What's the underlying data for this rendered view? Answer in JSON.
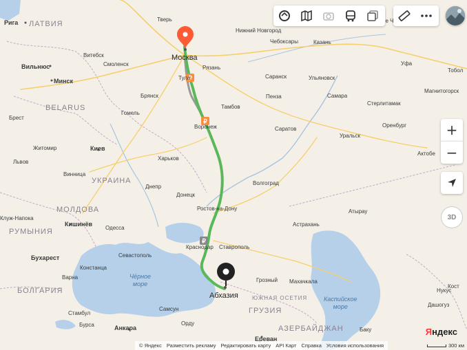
{
  "toolbar": {
    "buttons": [
      "layers-icon",
      "map-atlas-icon",
      "panorama-icon",
      "transport-icon",
      "offline-maps-icon"
    ],
    "ruler": "ruler-icon",
    "more": "more-icon",
    "avatar": "user-avatar"
  },
  "controls": {
    "zoom_in": "+",
    "zoom_out": "−",
    "geolocation": "location-arrow-icon",
    "tilt": "3D"
  },
  "route": {
    "start": "Москва",
    "end": "Абхазия",
    "color": "#5ab75a",
    "pin_start_color": "#ff5a36",
    "pin_end_color": "#222222"
  },
  "labels": {
    "cities": [
      {
        "name": "Рига",
        "cls": "bold"
      },
      {
        "name": "ЛАТВИЯ",
        "cls": "country"
      },
      {
        "name": "Тверь",
        "cls": ""
      },
      {
        "name": "Москва",
        "cls": "big"
      },
      {
        "name": "Нижний Новгород",
        "cls": ""
      },
      {
        "name": "Чебоксары",
        "cls": ""
      },
      {
        "name": "Казань",
        "cls": ""
      },
      {
        "name": "Набережные Челны",
        "cls": ""
      },
      {
        "name": "Уфа",
        "cls": ""
      },
      {
        "name": "Витебск",
        "cls": ""
      },
      {
        "name": "Смоленск",
        "cls": ""
      },
      {
        "name": "Вильнюс",
        "cls": "bold"
      },
      {
        "name": "Минск",
        "cls": "bold"
      },
      {
        "name": "Рязань",
        "cls": ""
      },
      {
        "name": "Тула",
        "cls": ""
      },
      {
        "name": "Саранск",
        "cls": ""
      },
      {
        "name": "Ульяновск",
        "cls": ""
      },
      {
        "name": "Брянск",
        "cls": ""
      },
      {
        "name": "Пенза",
        "cls": ""
      },
      {
        "name": "Самара",
        "cls": ""
      },
      {
        "name": "Стерлитамак",
        "cls": ""
      },
      {
        "name": "Магнитогорск",
        "cls": ""
      },
      {
        "name": "BELARUS",
        "cls": "country"
      },
      {
        "name": "Гомель",
        "cls": ""
      },
      {
        "name": "Тамбов",
        "cls": ""
      },
      {
        "name": "Брест",
        "cls": ""
      },
      {
        "name": "Воронеж",
        "cls": ""
      },
      {
        "name": "Саратов",
        "cls": ""
      },
      {
        "name": "Оренбург",
        "cls": ""
      },
      {
        "name": "Уральск",
        "cls": ""
      },
      {
        "name": "Киев",
        "cls": "bold"
      },
      {
        "name": "Житомир",
        "cls": ""
      },
      {
        "name": "Харьков",
        "cls": ""
      },
      {
        "name": "Актобе",
        "cls": ""
      },
      {
        "name": "Львов",
        "cls": ""
      },
      {
        "name": "Винница",
        "cls": ""
      },
      {
        "name": "УКРАИНА",
        "cls": "country"
      },
      {
        "name": "Волгоград",
        "cls": ""
      },
      {
        "name": "Днепр",
        "cls": ""
      },
      {
        "name": "Донецк",
        "cls": ""
      },
      {
        "name": "Ростов-на-Дону",
        "cls": ""
      },
      {
        "name": "Атырау",
        "cls": ""
      },
      {
        "name": "МОЛДОВА",
        "cls": "country"
      },
      {
        "name": "Клуж-Напока",
        "cls": ""
      },
      {
        "name": "Кишинёв",
        "cls": "bold"
      },
      {
        "name": "Одесса",
        "cls": ""
      },
      {
        "name": "РУМЫНИЯ",
        "cls": "country"
      },
      {
        "name": "Астрахань",
        "cls": ""
      },
      {
        "name": "Краснодар",
        "cls": ""
      },
      {
        "name": "Ставрополь",
        "cls": ""
      },
      {
        "name": "Бухарест",
        "cls": "bold"
      },
      {
        "name": "Севастополь",
        "cls": ""
      },
      {
        "name": "Констанца",
        "cls": ""
      },
      {
        "name": "Варна",
        "cls": ""
      },
      {
        "name": "Абхазия",
        "cls": "big"
      },
      {
        "name": "Грозный",
        "cls": ""
      },
      {
        "name": "Махачкала",
        "cls": ""
      },
      {
        "name": "БОЛГАРИЯ",
        "cls": "country"
      },
      {
        "name": "ЮЖНАЯ ОСЕТИЯ",
        "cls": "region"
      },
      {
        "name": "ГРУЗИЯ",
        "cls": "country"
      },
      {
        "name": "Стамбул",
        "cls": ""
      },
      {
        "name": "Бурса",
        "cls": ""
      },
      {
        "name": "Самсун",
        "cls": ""
      },
      {
        "name": "Анкара",
        "cls": "bold"
      },
      {
        "name": "Орду",
        "cls": ""
      },
      {
        "name": "АЗЕРБАЙДЖАН",
        "cls": "country"
      },
      {
        "name": "Ереван",
        "cls": "bold"
      },
      {
        "name": "Баку",
        "cls": ""
      },
      {
        "name": "Дашогуз",
        "cls": ""
      },
      {
        "name": "Нукус",
        "cls": ""
      },
      {
        "name": "Тобол",
        "cls": ""
      },
      {
        "name": "Кост",
        "cls": ""
      }
    ],
    "seas": [
      {
        "name": "Чёрное\nморе"
      },
      {
        "name": "Каспийское\nморе"
      }
    ]
  },
  "footer": {
    "copyright": "© Яндекс",
    "links": [
      "Разместить рекламу",
      "Редактировать карту",
      "API Карт",
      "Справка",
      "Условия использования"
    ],
    "scale": "300 км"
  },
  "logo": {
    "y": "Я",
    "rest": "ндекс"
  }
}
